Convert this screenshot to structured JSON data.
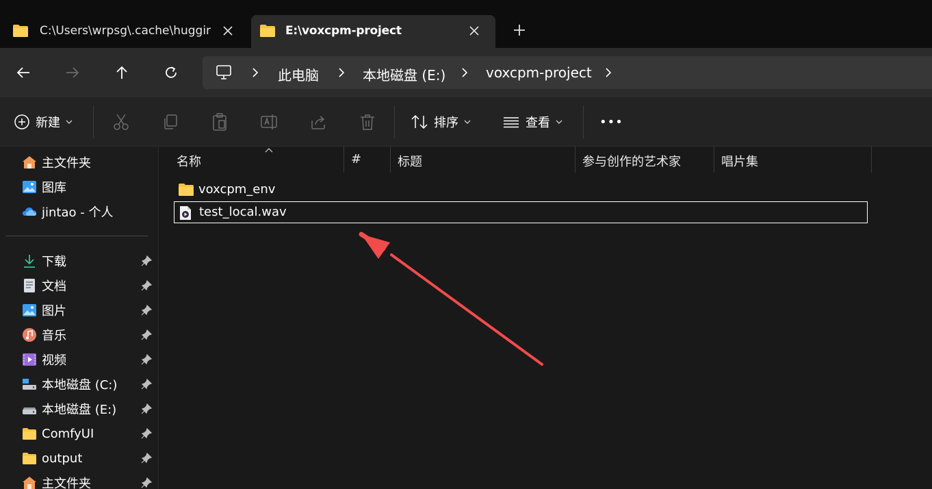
{
  "tabs": [
    {
      "label": "C:\\Users\\wrpsg\\.cache\\hugging",
      "active": false
    },
    {
      "label": "E:\\voxcpm-project",
      "active": true
    }
  ],
  "address": {
    "root_icon": "computer-icon",
    "crumbs": [
      "此电脑",
      "本地磁盘 (E:)",
      "voxcpm-project"
    ]
  },
  "toolbar": {
    "new_label": "新建",
    "sort_label": "排序",
    "view_label": "查看",
    "more_label": "•••"
  },
  "sidebar": {
    "top_items": [
      {
        "label": "主文件夹",
        "icon": "home-icon"
      },
      {
        "label": "图库",
        "icon": "gallery-icon"
      },
      {
        "label": "jintao - 个人",
        "icon": "onedrive-icon"
      }
    ],
    "pinned_items": [
      {
        "label": "下载",
        "icon": "download-icon"
      },
      {
        "label": "文档",
        "icon": "document-icon"
      },
      {
        "label": "图片",
        "icon": "pictures-icon"
      },
      {
        "label": "音乐",
        "icon": "music-icon"
      },
      {
        "label": "视频",
        "icon": "video-icon"
      },
      {
        "label": "本地磁盘 (C:)",
        "icon": "drive-c-icon"
      },
      {
        "label": "本地磁盘 (E:)",
        "icon": "drive-icon"
      },
      {
        "label": "ComfyUI",
        "icon": "folder-icon"
      },
      {
        "label": "output",
        "icon": "folder-icon"
      },
      {
        "label": "主文件夹",
        "icon": "home-icon"
      }
    ]
  },
  "columns": [
    "名称",
    "#",
    "标题",
    "参与创作的艺术家",
    "唱片集"
  ],
  "files": [
    {
      "name": "voxcpm_env",
      "type": "folder",
      "selected": false
    },
    {
      "name": "test_local.wav",
      "type": "audio",
      "selected": true
    }
  ],
  "colors": {
    "folder": "#f6c343",
    "accent": "#60cdff",
    "annotation_arrow": "#f24b4b"
  }
}
